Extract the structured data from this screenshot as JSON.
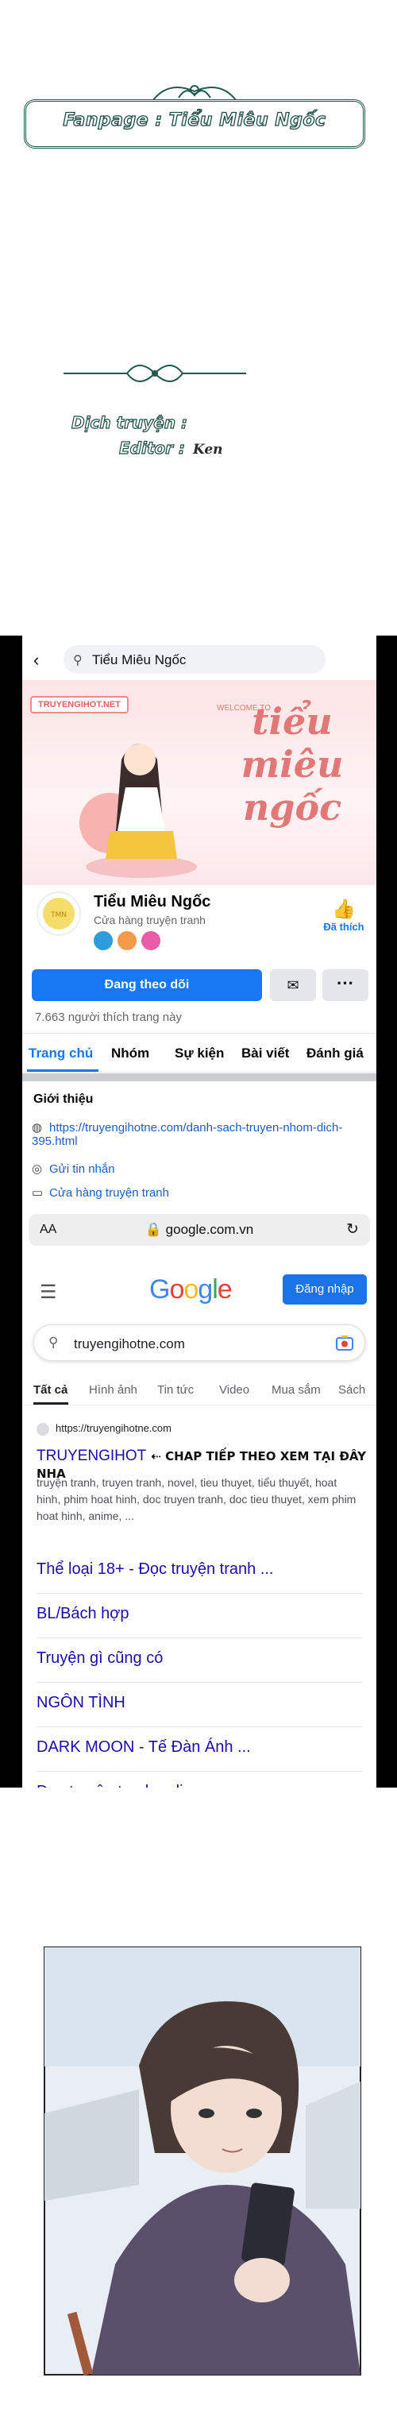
{
  "banner": {
    "text": "Fanpage : Tiểu Miêu Ngốc"
  },
  "credits": {
    "translator_label": "Dịch truyện :",
    "editor_label": "Editor :",
    "editor_name": "Ken"
  },
  "facebook": {
    "search_text": "Tiểu Miêu Ngốc",
    "cover": {
      "badge": "TRUYENGIHOT.NET",
      "welcome": "WELCOME TO",
      "title": "tiểu miêu ngốc"
    },
    "page_name": "Tiểu Miêu Ngốc",
    "page_category": "Cửa hàng truyện tranh",
    "liked_label": "Đã thích",
    "follow_label": "Đang theo dõi",
    "more_label": "···",
    "likes_count": "7.663 người thích trang này",
    "tabs": [
      "Trang chủ",
      "Nhóm",
      "Sự kiện",
      "Bài viết",
      "Đánh giá"
    ],
    "about_title": "Giới thiệu",
    "about_link": "https://truyengihotne.com/danh-sach-truyen-nhom-dich-395.html",
    "about_message": "Gửi tin nhắn",
    "about_store": "Cửa hàng truyện tranh"
  },
  "browser": {
    "aa_label": "AA",
    "domain": "google.com.vn"
  },
  "google": {
    "login_label": "Đăng nhập",
    "query": "truyengihotne.com",
    "tabs": [
      "Tất cả",
      "Hình ảnh",
      "Tin tức",
      "Video",
      "Mua sắm",
      "Sách"
    ],
    "result_site": "https://truyengihotne.com",
    "result_title": "TRUYENGIHOT",
    "result_note": "⇠ CHAP TIẾP THEO XEM TẠI ĐÂY NHA",
    "result_snippet": "truyện tranh, truyen tranh, novel, tieu thuyet, tiểu thuyết, hoat hinh, phim hoat hinh, doc truyen tranh, doc tieu thuyet, xem phim hoat hinh, anime, ...",
    "sitelinks": [
      "Thể loại 18+ - Đọc truyện tranh ...",
      "BL/Bách hợp",
      "Truyện gì cũng có",
      "NGÔN TÌNH",
      "DARK MOON - Tế Đàn Ánh ...",
      "Đọc truyện tranh online"
    ]
  },
  "colors": {
    "fb_blue": "#1877f2",
    "google_link": "#1a0dab",
    "banner_green": "#1b4d40"
  }
}
